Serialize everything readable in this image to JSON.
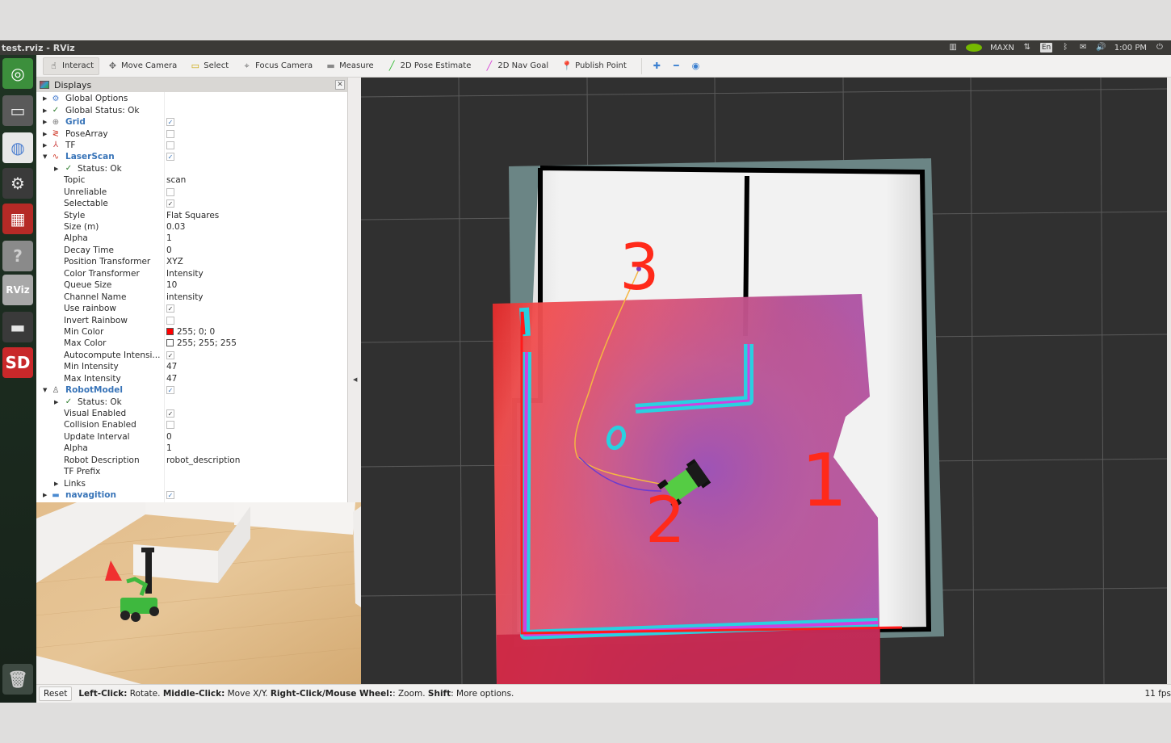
{
  "window": {
    "title": "test.rviz - RViz"
  },
  "system_tray": {
    "items": [
      {
        "name": "system-monitor-icon",
        "glyph": "▥"
      },
      {
        "name": "nvidia-icon",
        "glyph": ""
      },
      {
        "name": "power-mode-label",
        "text": "MAXN"
      },
      {
        "name": "network-icon",
        "glyph": "⇅"
      },
      {
        "name": "keyboard-layout-icon",
        "text": "En"
      },
      {
        "name": "bluetooth-icon",
        "glyph": "ᛒ"
      },
      {
        "name": "mail-icon",
        "glyph": "✉"
      },
      {
        "name": "volume-icon",
        "glyph": "🔊"
      }
    ],
    "power_mode": "MAXN",
    "keyboard": "En",
    "clock": "1:00 PM",
    "power_icon": "⏻"
  },
  "launcher": [
    {
      "name": "ubuntu-dash-icon",
      "glyph": "◎",
      "bg": "#3c8f3c",
      "fg": "#fff"
    },
    {
      "name": "files-icon",
      "glyph": "▭",
      "bg": "#5a5a5a",
      "fg": "#eee"
    },
    {
      "name": "software-center-icon",
      "glyph": "◍",
      "bg": "#e8e8e8",
      "fg": "#4d7fd0"
    },
    {
      "name": "system-settings-icon",
      "glyph": "⚙",
      "bg": "#3a3a3a",
      "fg": "#e8e8e8"
    },
    {
      "name": "workspace-switcher-icon",
      "glyph": "▦",
      "bg": "#b52a26",
      "fg": "#fff"
    },
    {
      "name": "help-icon",
      "glyph": "?",
      "bg": "#8a8a8a",
      "fg": "#cfcfcf"
    },
    {
      "name": "rviz-icon",
      "glyph": "RViz",
      "bg": "#a8a8a8",
      "fg": "#fff"
    },
    {
      "name": "drive-icon",
      "glyph": "▬",
      "bg": "#3a3a3a",
      "fg": "#e5e5e5"
    },
    {
      "name": "sd-card-icon",
      "glyph": "SD",
      "bg": "#c8282a",
      "fg": "#fff"
    },
    {
      "name": "trash-icon",
      "glyph": "🗑",
      "bg": "#3e4a42",
      "fg": "#ccc"
    }
  ],
  "toolbar": {
    "tools": [
      {
        "name": "interact",
        "label": "Interact",
        "icon": "☝",
        "color": "#333",
        "active": true
      },
      {
        "name": "move-camera",
        "label": "Move Camera",
        "icon": "✥",
        "color": "#666",
        "active": false
      },
      {
        "name": "select",
        "label": "Select",
        "icon": "▭",
        "color": "#c9a400",
        "active": false
      },
      {
        "name": "focus-camera",
        "label": "Focus Camera",
        "icon": "⌖",
        "color": "#777",
        "active": false
      },
      {
        "name": "measure",
        "label": "Measure",
        "icon": "▬",
        "color": "#888",
        "active": false
      },
      {
        "name": "2d-pose-estimate",
        "label": "2D Pose Estimate",
        "icon": "╱",
        "color": "#2db92d",
        "active": false
      },
      {
        "name": "2d-nav-goal",
        "label": "2D Nav Goal",
        "icon": "╱",
        "color": "#d63cd6",
        "active": false
      },
      {
        "name": "publish-point",
        "label": "Publish Point",
        "icon": "📍",
        "color": "#c8501e",
        "active": false
      }
    ],
    "extra_icons": [
      {
        "name": "add-tool-icon",
        "glyph": "✚",
        "color": "#3a7fd0"
      },
      {
        "name": "remove-tool-icon",
        "glyph": "━",
        "color": "#3a7fd0"
      },
      {
        "name": "tool-properties-icon",
        "glyph": "◉",
        "color": "#3a7fd0"
      }
    ]
  },
  "displays_panel": {
    "title": "Displays",
    "close_glyph": "✕",
    "rows": [
      {
        "indent": 0,
        "arrow": "▶",
        "icon": "⚙",
        "icon_color": "#4a7fd0",
        "label": "Global Options",
        "blue": false,
        "value": "",
        "check": null
      },
      {
        "indent": 0,
        "arrow": "▶",
        "icon": "✓",
        "icon_color": "#2a7a2a",
        "label": "Global Status: Ok",
        "blue": false,
        "value": "",
        "check": null
      },
      {
        "indent": 0,
        "arrow": "▶",
        "icon": "⊕",
        "icon_color": "#777",
        "label": "Grid",
        "blue": true,
        "value": "",
        "check": true
      },
      {
        "indent": 0,
        "arrow": "▶",
        "icon": "≷",
        "icon_color": "#d03a2a",
        "label": "PoseArray",
        "blue": false,
        "value": "",
        "check": false
      },
      {
        "indent": 0,
        "arrow": "▶",
        "icon": "⅄",
        "icon_color": "#c44",
        "label": "TF",
        "blue": false,
        "value": "",
        "check": false
      },
      {
        "indent": 0,
        "arrow": "▼",
        "icon": "∿",
        "icon_color": "#d03a2a",
        "label": "LaserScan",
        "blue": true,
        "value": "",
        "check": true
      },
      {
        "indent": 1,
        "arrow": "▶",
        "icon": "✓",
        "icon_color": "#2a7a2a",
        "label": "Status: Ok",
        "blue": false,
        "value": "",
        "check": null
      },
      {
        "indent": 2,
        "arrow": "",
        "icon": "",
        "label": "Topic",
        "blue": false,
        "value": "scan",
        "check": null
      },
      {
        "indent": 2,
        "arrow": "",
        "icon": "",
        "label": "Unreliable",
        "blue": false,
        "value": "",
        "check": false
      },
      {
        "indent": 2,
        "arrow": "",
        "icon": "",
        "label": "Selectable",
        "blue": false,
        "value": "",
        "check": true
      },
      {
        "indent": 2,
        "arrow": "",
        "icon": "",
        "label": "Style",
        "blue": false,
        "value": "Flat Squares",
        "check": null
      },
      {
        "indent": 2,
        "arrow": "",
        "icon": "",
        "label": "Size (m)",
        "blue": false,
        "value": "0.03",
        "check": null
      },
      {
        "indent": 2,
        "arrow": "",
        "icon": "",
        "label": "Alpha",
        "blue": false,
        "value": "1",
        "check": null
      },
      {
        "indent": 2,
        "arrow": "",
        "icon": "",
        "label": "Decay Time",
        "blue": false,
        "value": "0",
        "check": null
      },
      {
        "indent": 2,
        "arrow": "",
        "icon": "",
        "label": "Position Transformer",
        "blue": false,
        "value": "XYZ",
        "check": null
      },
      {
        "indent": 2,
        "arrow": "",
        "icon": "",
        "label": "Color Transformer",
        "blue": false,
        "value": "Intensity",
        "check": null
      },
      {
        "indent": 2,
        "arrow": "",
        "icon": "",
        "label": "Queue Size",
        "blue": false,
        "value": "10",
        "check": null
      },
      {
        "indent": 2,
        "arrow": "",
        "icon": "",
        "label": "Channel Name",
        "blue": false,
        "value": "intensity",
        "check": null
      },
      {
        "indent": 2,
        "arrow": "",
        "icon": "",
        "label": "Use rainbow",
        "blue": false,
        "value": "",
        "check": true
      },
      {
        "indent": 2,
        "arrow": "",
        "icon": "",
        "label": "Invert Rainbow",
        "blue": false,
        "value": "",
        "check": false
      },
      {
        "indent": 2,
        "arrow": "",
        "icon": "",
        "label": "Min Color",
        "blue": false,
        "value": "255; 0; 0",
        "swatch": "#ff0000",
        "check": null
      },
      {
        "indent": 2,
        "arrow": "",
        "icon": "",
        "label": "Max Color",
        "blue": false,
        "value": "255; 255; 255",
        "swatch": "#ffffff",
        "check": null
      },
      {
        "indent": 2,
        "arrow": "",
        "icon": "",
        "label": "Autocompute Intensi...",
        "blue": false,
        "value": "",
        "check": true
      },
      {
        "indent": 2,
        "arrow": "",
        "icon": "",
        "label": "Min Intensity",
        "blue": false,
        "value": "47",
        "check": null
      },
      {
        "indent": 2,
        "arrow": "",
        "icon": "",
        "label": "Max Intensity",
        "blue": false,
        "value": "47",
        "check": null
      },
      {
        "indent": 0,
        "arrow": "▼",
        "icon": "♙",
        "icon_color": "#555",
        "label": "RobotModel",
        "blue": true,
        "value": "",
        "check": true
      },
      {
        "indent": 1,
        "arrow": "▶",
        "icon": "✓",
        "icon_color": "#2a7a2a",
        "label": "Status: Ok",
        "blue": false,
        "value": "",
        "check": null
      },
      {
        "indent": 2,
        "arrow": "",
        "icon": "",
        "label": "Visual Enabled",
        "blue": false,
        "value": "",
        "check": true
      },
      {
        "indent": 2,
        "arrow": "",
        "icon": "",
        "label": "Collision Enabled",
        "blue": false,
        "value": "",
        "check": false
      },
      {
        "indent": 2,
        "arrow": "",
        "icon": "",
        "label": "Update Interval",
        "blue": false,
        "value": "0",
        "check": null
      },
      {
        "indent": 2,
        "arrow": "",
        "icon": "",
        "label": "Alpha",
        "blue": false,
        "value": "1",
        "check": null
      },
      {
        "indent": 2,
        "arrow": "",
        "icon": "",
        "label": "Robot Description",
        "blue": false,
        "value": "robot_description",
        "check": null
      },
      {
        "indent": 2,
        "arrow": "",
        "icon": "",
        "label": "TF Prefix",
        "blue": false,
        "value": "",
        "check": null
      },
      {
        "indent": 1,
        "arrow": "▶",
        "icon": "",
        "label": "Links",
        "blue": false,
        "value": "",
        "check": null,
        "links": true
      },
      {
        "indent": 0,
        "arrow": "▶",
        "icon": "▬",
        "icon_color": "#4a8ad0",
        "label": "navagition",
        "blue": true,
        "value": "",
        "check": true
      }
    ]
  },
  "viewport": {
    "goal_labels": [
      "3",
      "2",
      "1"
    ],
    "colors": {
      "background": "#303030",
      "grid": "#5a5a5a",
      "unknown": "#6b8585",
      "free": "#ececec",
      "wall": "#000000",
      "costmap_high": "#ff4444",
      "costmap_low": "#9b4fc0",
      "inflation": "#2ad0e0",
      "laser": "#ff1a1a",
      "path_global": "#f5b642",
      "path_local": "#6a3cd0",
      "robot": "#55cc44",
      "labels": "#ff2a1a"
    }
  },
  "status_bar": {
    "reset_label": "Reset",
    "hint": [
      {
        "bold": "Left-Click:",
        "text": " Rotate. "
      },
      {
        "bold": "Middle-Click:",
        "text": " Move X/Y. "
      },
      {
        "bold": "Right-Click/Mouse Wheel:",
        "text": ": Zoom. "
      },
      {
        "bold": "Shift",
        "text": ": More options."
      }
    ],
    "fps": "11 fps"
  }
}
